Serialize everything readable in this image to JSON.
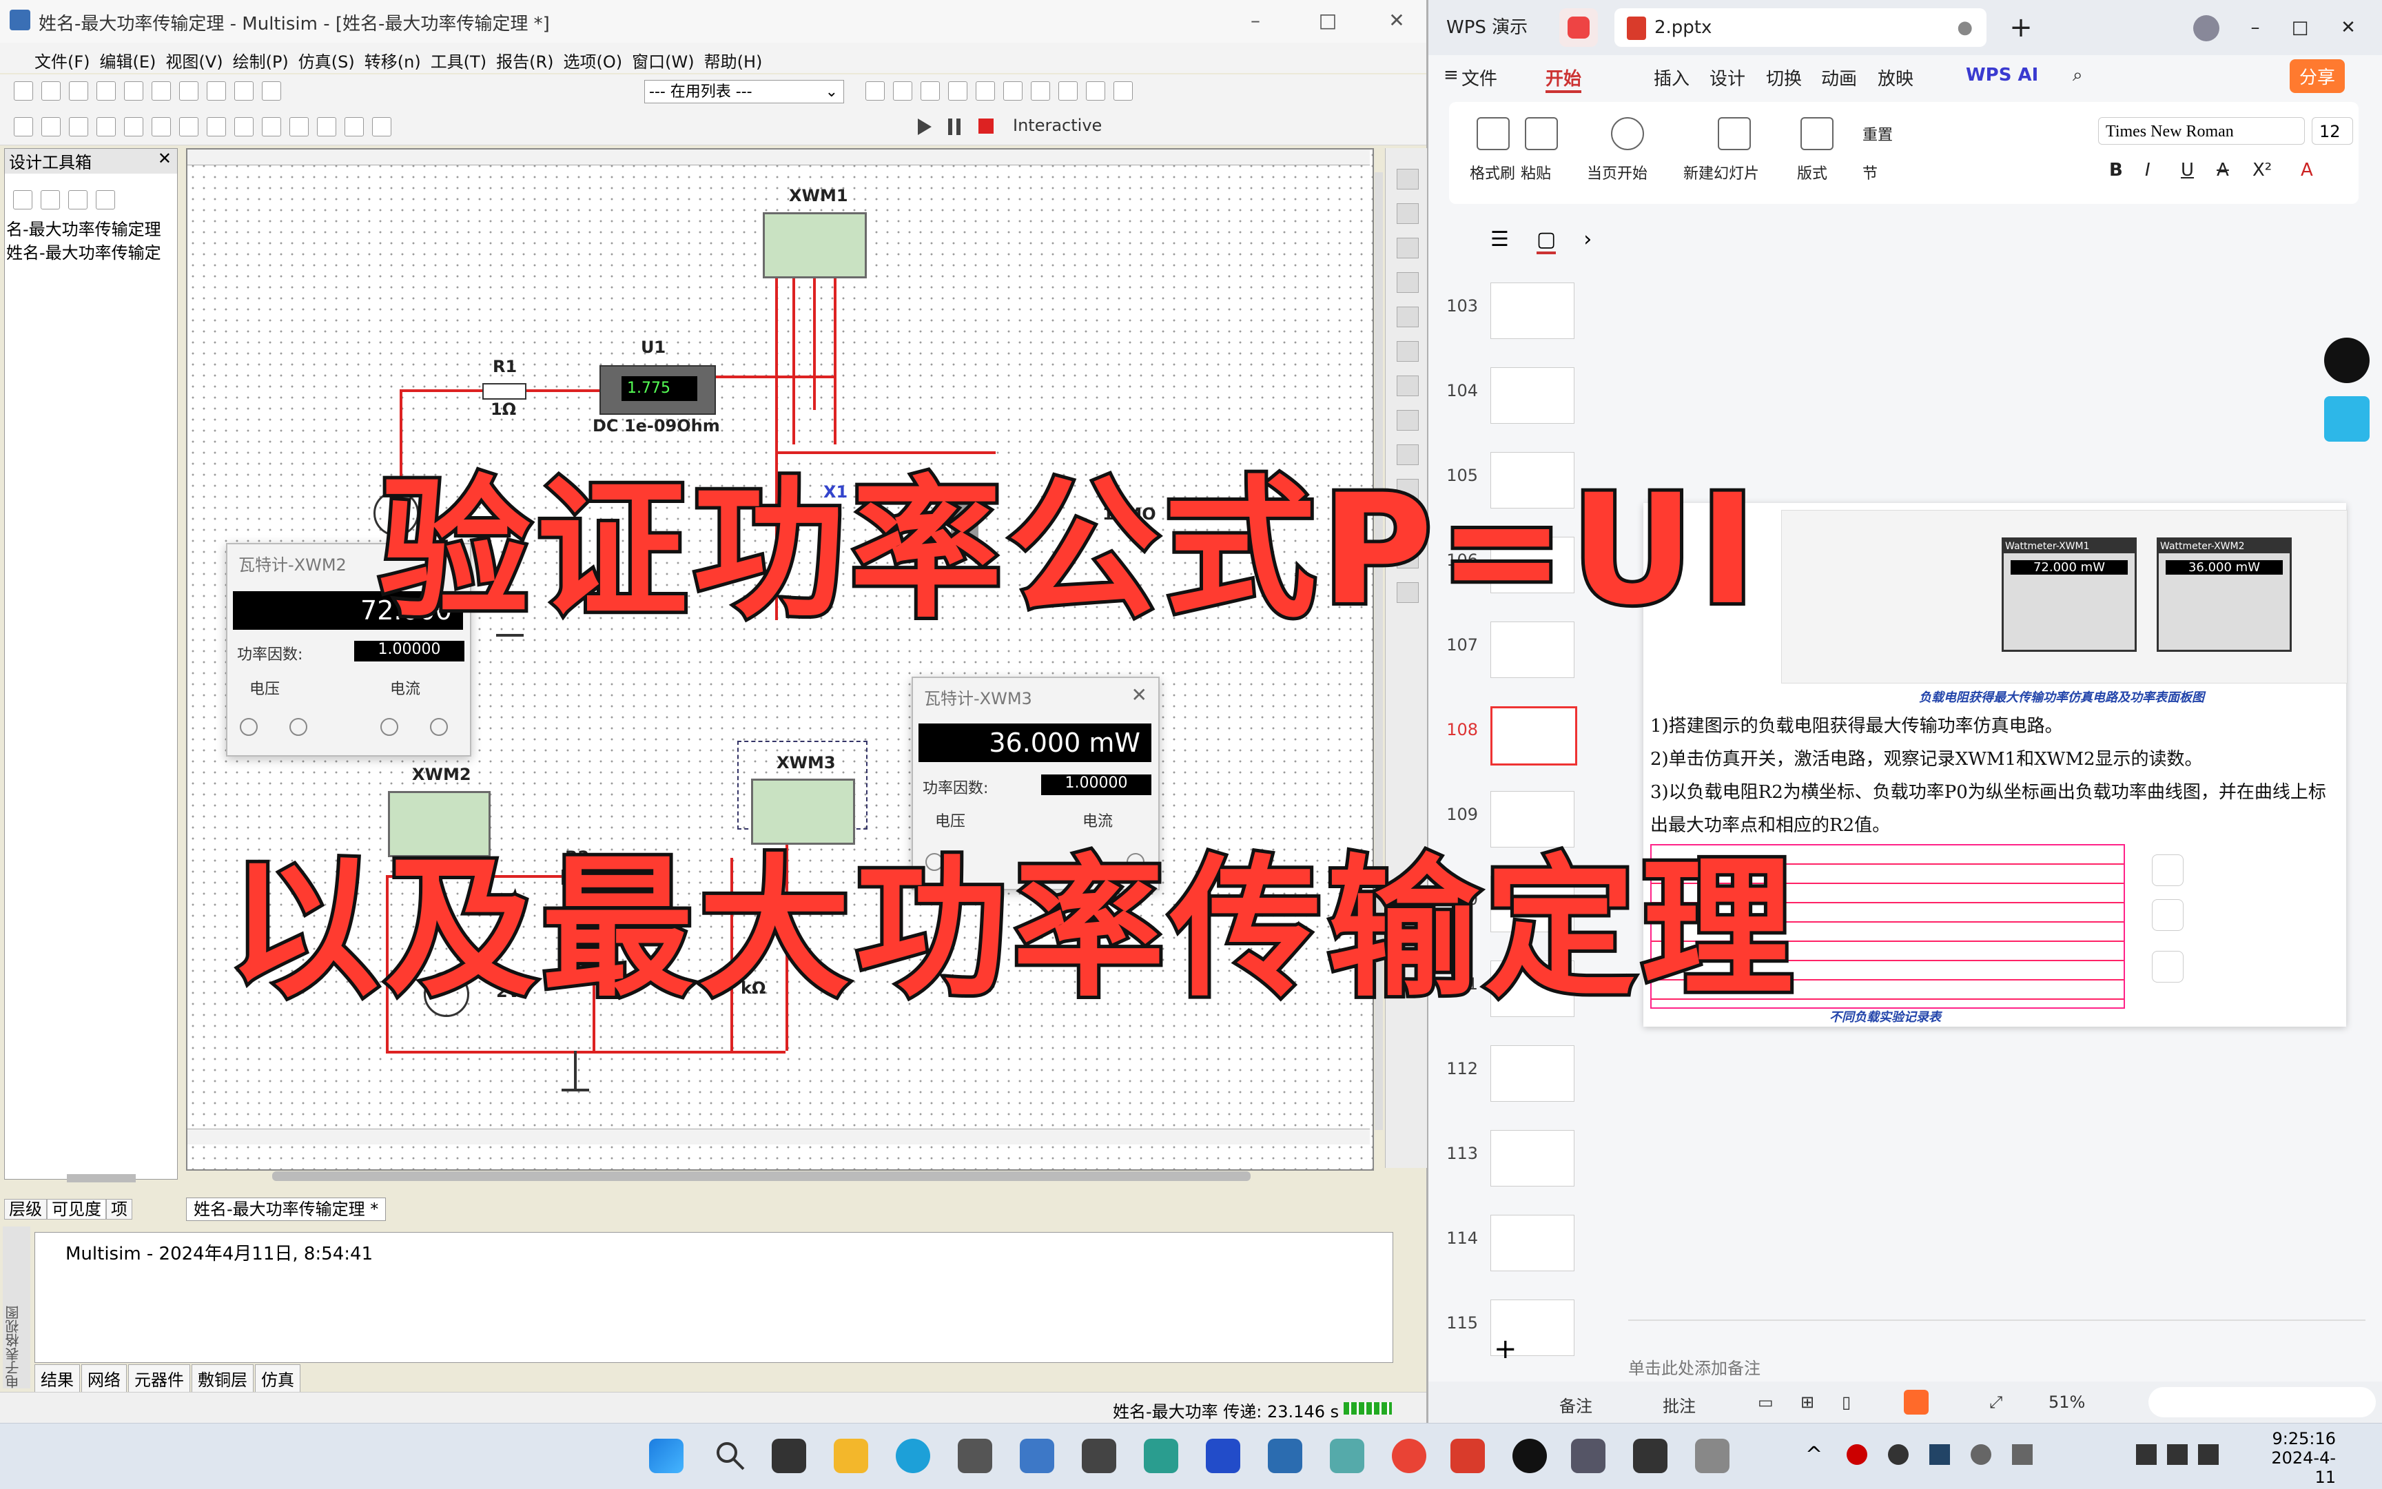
{
  "multisim": {
    "title": "姓名-最大功率传输定理 - Multisim - [姓名-最大功率传输定理 *]",
    "menu": [
      "文件(F)",
      "编辑(E)",
      "视图(V)",
      "绘制(P)",
      "仿真(S)",
      "转移(n)",
      "工具(T)",
      "报告(R)",
      "选项(O)",
      "窗口(W)",
      "帮助(H)"
    ],
    "in_use_list": "--- 在用列表 ---",
    "interactive": "Interactive",
    "design_toolbox": "设计工具箱",
    "tree": [
      "名-最大功率传输定理",
      "姓名-最大功率传输定"
    ],
    "left_tabs": [
      "层级",
      "可见度",
      "项"
    ],
    "doc_tab": "姓名-最大功率传输定理 *",
    "output_line": "Multisim  -  2024年4月11日, 8:54:41",
    "bottom_tabs": [
      "结果",
      "网络",
      "元器件",
      "敷铜层",
      "仿真"
    ],
    "side_label": "电子表格视图",
    "status": "姓名-最大功率 传递: 23.146 s",
    "circuit": {
      "xwm1": "XWM1",
      "u1": "U1",
      "u1_value": "1.775",
      "u1_mode": "DC  1e-09Ohm",
      "r1": "R1",
      "r1_value": "1Ω",
      "x1": "X1",
      "r_10m": "10MO",
      "xwm2": "XWM2",
      "xwm3": "XWM3",
      "r2": "R2",
      "r2_value": "1kΩ",
      "r3": "R3",
      "r3_value": "kΩ",
      "v_label": "2V"
    },
    "wattmeter2": {
      "title": "瓦特计-XWM2",
      "reading": "72.000",
      "pf_label": "功率因数:",
      "pf": "1.00000",
      "voltage": "电压",
      "current": "电流"
    },
    "wattmeter3": {
      "title": "瓦特计-XWM3",
      "reading": "36.000 mW",
      "pf_label": "功率因数:",
      "pf": "1.00000",
      "voltage": "电压",
      "current": "电流"
    }
  },
  "wps": {
    "app_tab": "WPS 演示",
    "doc_tab": "2.pptx",
    "menu": [
      "文件",
      "开始",
      "插入",
      "设计",
      "切换",
      "动画",
      "放映"
    ],
    "ai": "WPS AI",
    "share": "分享",
    "ribbon": {
      "format_painter": "格式刷",
      "paste": "粘贴",
      "play_from": "当页开始",
      "new_slide": "新建幻灯片",
      "layout": "版式",
      "section": "节",
      "reset": "重置",
      "font": "Times New Roman",
      "size": "12"
    },
    "thumb_numbers": [
      "103",
      "104",
      "105",
      "106",
      "107",
      "108",
      "109",
      "110",
      "111",
      "112",
      "113",
      "114",
      "115"
    ],
    "active_slide": "108",
    "slide": {
      "caption": "负载电阻获得最大传输功率仿真电路及功率表面板图",
      "w1_title": "Wattmeter-XWM1",
      "w1_value": "72.000 mW",
      "w2_title": "Wattmeter-XWM2",
      "w2_value": "36.000 mW",
      "step1": "1)搭建图示的负载电阻获得最大传输功率仿真电路。",
      "step2": "2)单击仿真开关，激活电路，观察记录XWM1和XWM2显示的读数。",
      "step3": "3)以负载电阻R2为横坐标、负载功率P0为纵坐标画出负载功率曲线图，并在曲线上标出最大功率点和相应的R2值。",
      "table_caption": "不同负载实验记录表"
    },
    "notes_placeholder": "单击此处添加备注",
    "status": {
      "notes": "备注",
      "comment": "批注",
      "zoom": "51%"
    }
  },
  "taskbar": {
    "time": "9:25:16",
    "date": "2024-4-11"
  },
  "overlay": {
    "line1": "验证功率公式P=UI",
    "line2": "以及最大功率传输定理"
  }
}
